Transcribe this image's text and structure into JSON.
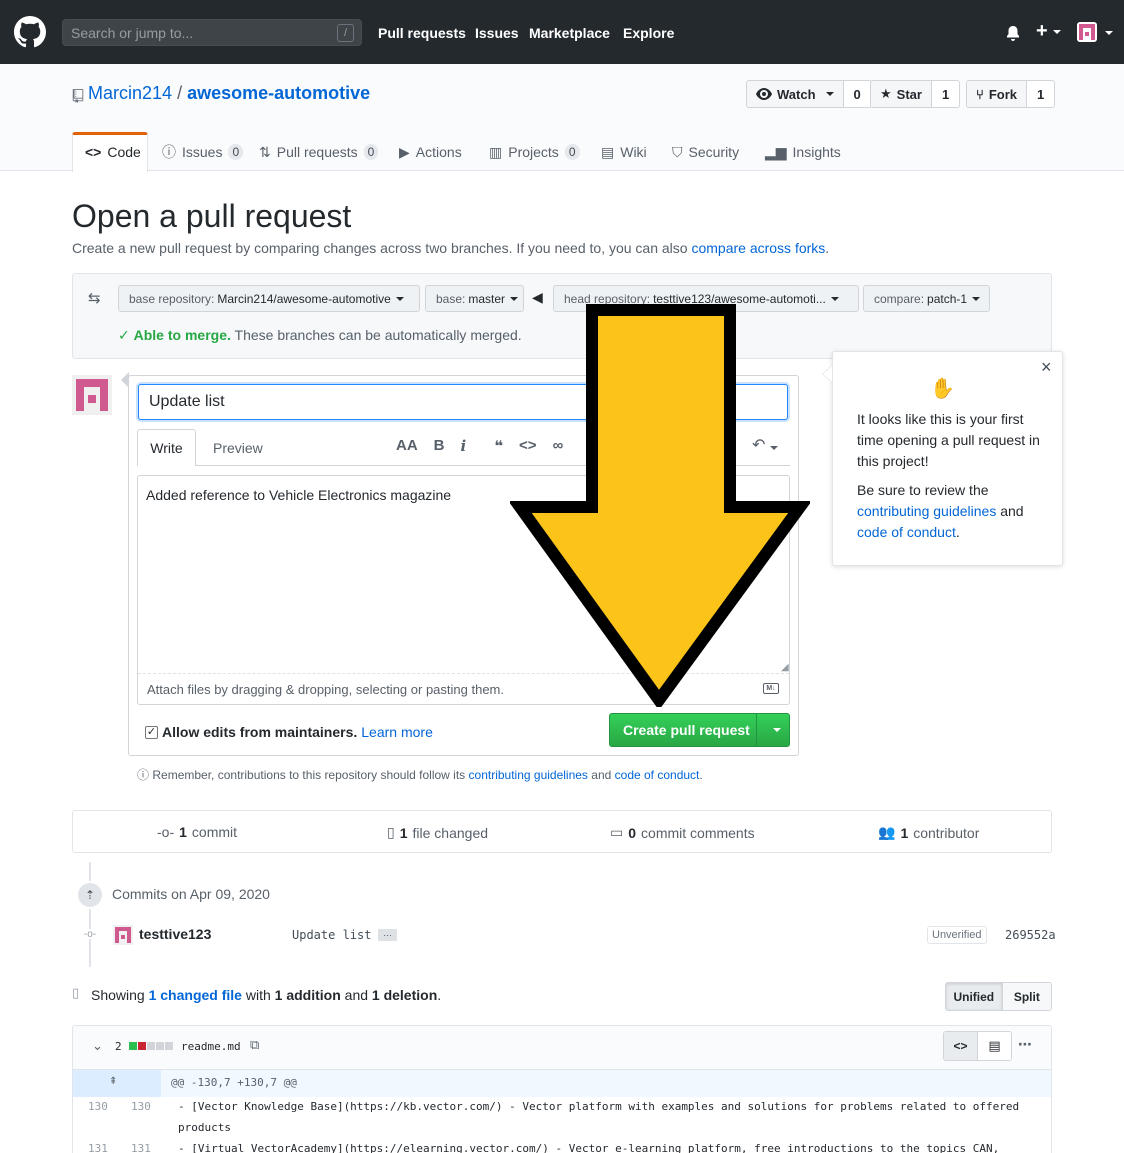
{
  "header": {
    "search_placeholder": "Search or jump to...",
    "search_shortcut": "/",
    "nav": [
      "Pull requests",
      "Issues",
      "Marketplace",
      "Explore"
    ]
  },
  "repo": {
    "owner": "Marcin214",
    "separator": "/",
    "name": "awesome-automotive",
    "watch": {
      "label": "Watch",
      "count": "0"
    },
    "star": {
      "label": "Star",
      "count": "1"
    },
    "fork": {
      "label": "Fork",
      "count": "1"
    }
  },
  "tabs": [
    {
      "label": "Code"
    },
    {
      "label": "Issues",
      "count": "0"
    },
    {
      "label": "Pull requests",
      "count": "0"
    },
    {
      "label": "Actions"
    },
    {
      "label": "Projects",
      "count": "0"
    },
    {
      "label": "Wiki"
    },
    {
      "label": "Security"
    },
    {
      "label": "Insights"
    }
  ],
  "page": {
    "title": "Open a pull request",
    "subtitle": "Create a new pull request by comparing changes across two branches. If you need to, you can also",
    "compare_link": "compare across forks",
    "period": "."
  },
  "compare": {
    "base_repo_label": "base repository:",
    "base_repo": "Marcin214/awesome-automotive",
    "base_label": "base:",
    "base": "master",
    "head_repo_label": "head repository:",
    "head_repo": "testtive123/awesome-automoti...",
    "compare_label": "compare:",
    "compare": "patch-1",
    "merge_status": "Able to merge.",
    "merge_text": "These branches can be automatically merged."
  },
  "form": {
    "title_value": "Update list",
    "tab_write": "Write",
    "tab_preview": "Preview",
    "body_value": "Added reference to Vehicle Electronics magazine",
    "attach_text": "Attach files by dragging & dropping, selecting or pasting them.",
    "allow_edits": "Allow edits from maintainers.",
    "learn_more": "Learn more",
    "submit": "Create pull request",
    "notice_pre": "Remember, contributions to this repository should follow its",
    "notice_link1": "contributing guidelines",
    "notice_and": "and",
    "notice_link2": "code of conduct",
    "notice_end": "."
  },
  "popover": {
    "line1": "It looks like this is your first time opening a pull request in this project!",
    "line2_pre": "Be sure to review the",
    "link1": "contributing guidelines",
    "line2_and": "and",
    "link2": "code of conduct",
    "line2_end": "."
  },
  "stats": {
    "commits_n": "1",
    "commits": "commit",
    "files_n": "1",
    "files": "file changed",
    "comments_n": "0",
    "comments": "commit comments",
    "contrib_n": "1",
    "contrib": "contributor"
  },
  "commits": {
    "date": "Commits on Apr 09, 2020",
    "author": "testtive123",
    "message": "Update list",
    "badge": "Unverified",
    "sha": "269552a"
  },
  "summary": {
    "pre": "Showing",
    "link": "1 changed file",
    "with": "with",
    "additions": "1 addition",
    "and": "and",
    "deletions": "1 deletion",
    "end": ".",
    "unified": "Unified",
    "split": "Split"
  },
  "diff": {
    "count": "2",
    "filename": "readme.md",
    "hunk": "@@ -130,7 +130,7 @@",
    "lines": [
      {
        "old": "130",
        "new": "130",
        "text": "- [Vector Knowledge Base](https://kb.vector.com/) - Vector platform with examples and solutions for problems related to offered",
        "cont": "products"
      },
      {
        "old": "131",
        "new": "131",
        "text": "- [Virtual VectorAcademy](https://elearning.vector.com/) - Vector e-learning platform, free introductions to the topics CAN,"
      }
    ]
  },
  "colors": {
    "header_bg": "#24292e",
    "link": "#0366d6",
    "green": "#28a745",
    "arrow": "#fcc418",
    "avatar": "#d05a8f"
  }
}
